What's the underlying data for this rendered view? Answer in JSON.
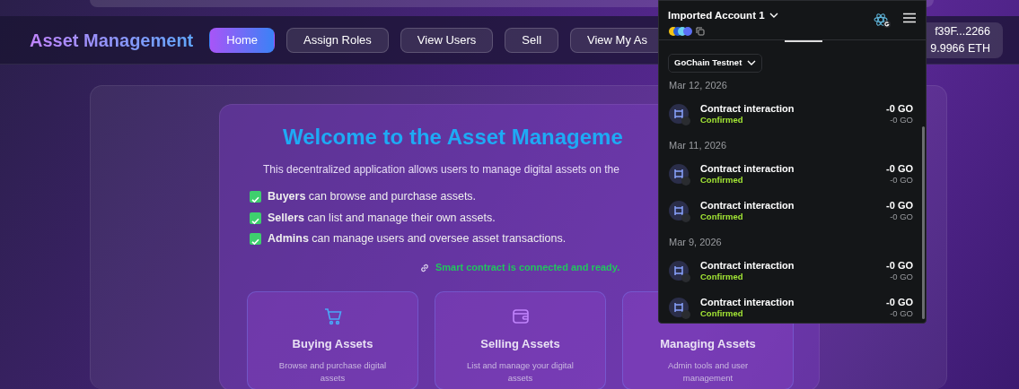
{
  "navbar": {
    "brand": "Asset Management",
    "tabs": [
      {
        "label": "Home",
        "selected": true
      },
      {
        "label": "Assign Roles",
        "selected": false
      },
      {
        "label": "View Users",
        "selected": false
      },
      {
        "label": "Sell",
        "selected": false
      },
      {
        "label": "View My As",
        "selected": false
      }
    ],
    "account": {
      "address": "f39F...2266",
      "balance": "9.9966 ETH"
    }
  },
  "welcome": {
    "title": "Welcome to the Asset Manageme",
    "intro": "This decentralized application allows users to manage digital assets on the",
    "roles": [
      "**Buyers** can browse and purchase assets.",
      "**Sellers** can list and manage their own assets.",
      "**Admins** can manage users and oversee asset transactions."
    ],
    "status": "Smart contract is connected and ready."
  },
  "features": [
    {
      "kind": "cart",
      "title": "Buying Assets",
      "description": "Browse and purchase digital assets"
    },
    {
      "kind": "wallet",
      "title": "Selling Assets",
      "description": "List and manage your digital assets"
    },
    {
      "title": "Managing Assets",
      "description": "Admin tools and user management"
    }
  ],
  "wallet": {
    "account": "Imported Account 1",
    "network": "GoChain Testnet",
    "groups": [
      {
        "date": "Mar 12, 2026",
        "transactions": [
          {
            "title": "Contract interaction",
            "status": "Confirmed",
            "amount": "-0 GO",
            "fiat": "-0 GO"
          }
        ]
      },
      {
        "date": "Mar 11, 2026",
        "transactions": [
          {
            "title": "Contract interaction",
            "status": "Confirmed",
            "amount": "-0 GO",
            "fiat": "-0 GO"
          },
          {
            "title": "Contract interaction",
            "status": "Confirmed",
            "amount": "-0 GO",
            "fiat": "-0 GO"
          }
        ]
      },
      {
        "date": "Mar 9, 2026",
        "transactions": [
          {
            "title": "Contract interaction",
            "status": "Confirmed",
            "amount": "-0 GO",
            "fiat": "-0 GO"
          },
          {
            "title": "Contract interaction",
            "status": "Confirmed",
            "amount": "-0 GO",
            "fiat": "-0 GO"
          }
        ]
      }
    ]
  }
}
